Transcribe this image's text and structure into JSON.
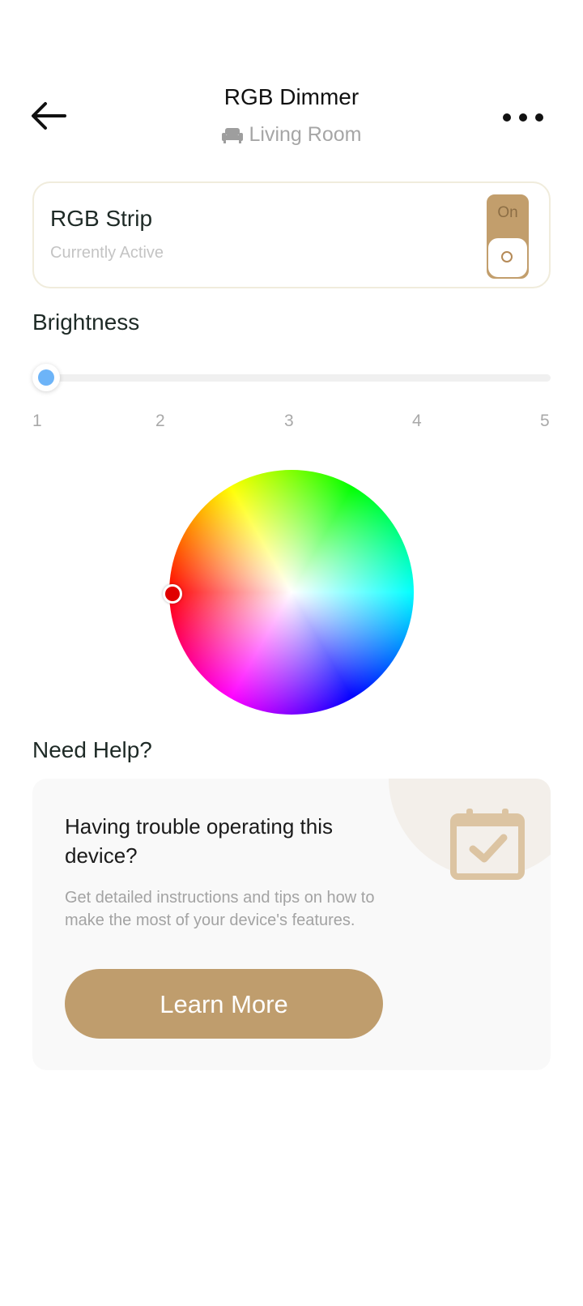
{
  "header": {
    "title": "RGB Dimmer",
    "room": "Living Room"
  },
  "device": {
    "name": "RGB Strip",
    "status": "Currently Active",
    "toggle_label": "On"
  },
  "brightness": {
    "label": "Brightness",
    "ticks": [
      "1",
      "2",
      "3",
      "4",
      "5"
    ],
    "value": 1
  },
  "color_picker": {
    "selected_color": "#e00000"
  },
  "help": {
    "label": "Need Help?",
    "title": "Having trouble operating this device?",
    "description": "Get detailed instructions and tips on how to make the most of your device's features.",
    "button_label": "Learn More"
  },
  "colors": {
    "accent": "#bf9d6d",
    "slider_thumb": "#6db4f8"
  }
}
